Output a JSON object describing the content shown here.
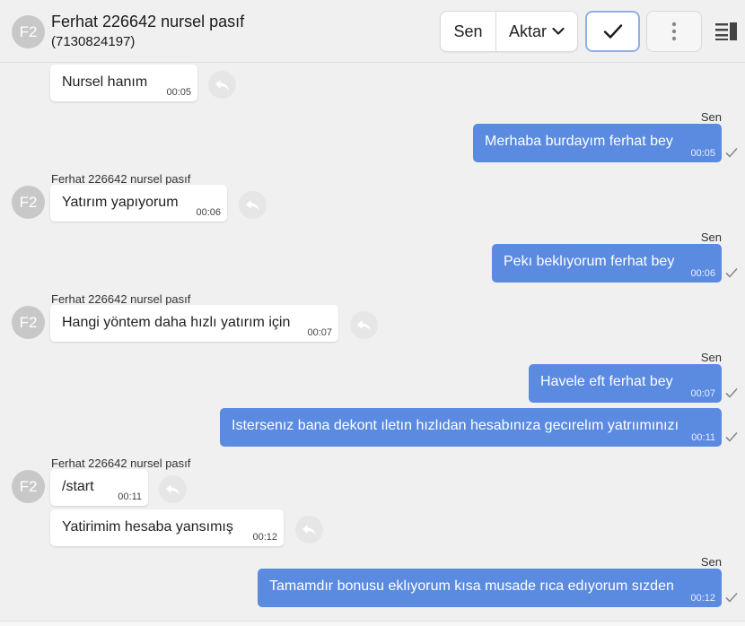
{
  "header": {
    "avatar_initials": "F2",
    "title": "Ferhat 226642 nursel pasıf",
    "subtitle": "(7130824197)",
    "sen_label": "Sen",
    "aktar_label": "Aktar"
  },
  "chat": {
    "sender_name": "Ferhat 226642 nursel pasıf",
    "self_label": "Sen",
    "avatar_initials": "F2",
    "messages": [
      {
        "text": "Nursel hanım",
        "time": "00:05"
      },
      {
        "text": "Merhaba burdayım ferhat bey",
        "time": "00:05"
      },
      {
        "text": "Yatırım yapıyorum",
        "time": "00:06"
      },
      {
        "text": "Pekı beklıyorum ferhat bey",
        "time": "00:06"
      },
      {
        "text": "Hangi yöntem daha hızlı yatırım için",
        "time": "00:07"
      },
      {
        "text": "Havele eft ferhat bey",
        "time": "00:07"
      },
      {
        "text": "Istersenız bana dekont ıletın hızlıdan hesabınıza gecırelım yatrıımınızı",
        "time": "00:11"
      },
      {
        "text": "/start",
        "time": "00:11"
      },
      {
        "text": "Yatirimim hesaba yansımış",
        "time": "00:12"
      },
      {
        "text": "Tamamdır bonusu eklıyorum kısa musade rıca edıyorum sızden",
        "time": "00:12"
      }
    ]
  },
  "colors": {
    "outgoing_bubble": "#5b8be0",
    "incoming_bubble": "#ffffff",
    "background": "#f0f0f0",
    "avatar": "#c8c8c8"
  },
  "icons": {
    "reply": "reply-icon",
    "check": "check-icon",
    "more": "more-vertical-icon",
    "panel": "side-panel-icon",
    "read": "read-tick-icon"
  }
}
